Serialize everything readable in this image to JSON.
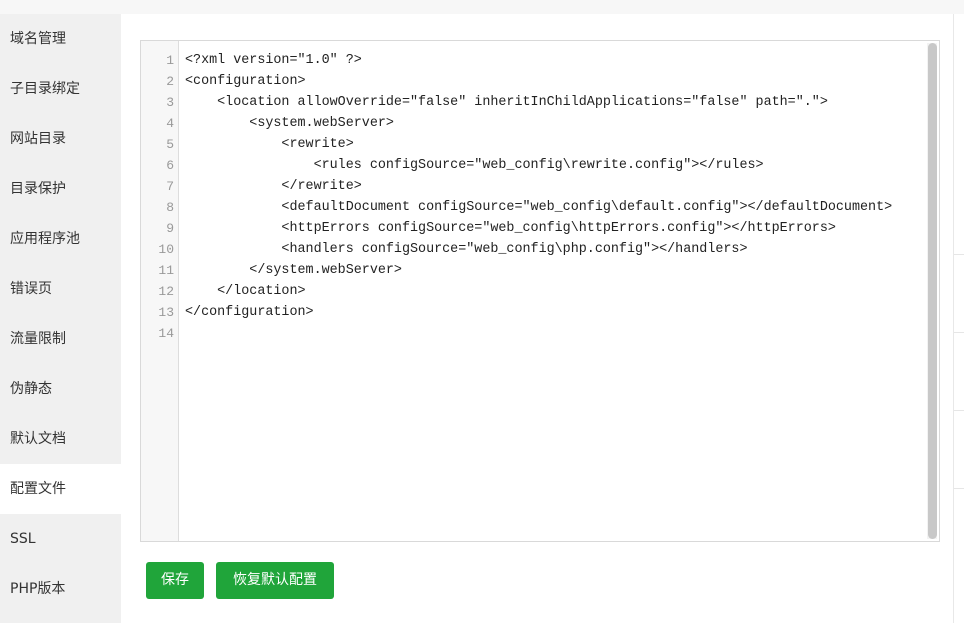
{
  "sidebar": {
    "items": [
      {
        "label": "域名管理"
      },
      {
        "label": "子目录绑定"
      },
      {
        "label": "网站目录"
      },
      {
        "label": "目录保护"
      },
      {
        "label": "应用程序池"
      },
      {
        "label": "错误页"
      },
      {
        "label": "流量限制"
      },
      {
        "label": "伪静态"
      },
      {
        "label": "默认文档"
      },
      {
        "label": "配置文件"
      },
      {
        "label": "SSL"
      },
      {
        "label": "PHP版本"
      }
    ],
    "active_label": "配置文件"
  },
  "editor": {
    "line_numbers": [
      "1",
      "2",
      "3",
      "4",
      "5",
      "6",
      "7",
      "8",
      "9",
      "10",
      "11",
      "12",
      "13",
      "14"
    ],
    "lines": [
      "<?xml version=\"1.0\" ?>",
      "<configuration>",
      "    <location allowOverride=\"false\" inheritInChildApplications=\"false\" path=\".\">",
      "        <system.webServer>",
      "            <rewrite>",
      "                <rules configSource=\"web_config\\rewrite.config\"></rules>",
      "            </rewrite>",
      "            <defaultDocument configSource=\"web_config\\default.config\"></defaultDocument>",
      "            <httpErrors configSource=\"web_config\\httpErrors.config\"></httpErrors>",
      "            <handlers configSource=\"web_config\\php.config\"></handlers>",
      "        </system.webServer>",
      "    </location>",
      "</configuration>",
      ""
    ]
  },
  "buttons": {
    "save_label": "保存",
    "restore_label": "恢复默认配置"
  },
  "colors": {
    "accent": "#20a53a",
    "sidebar_bg": "#f0f0f0",
    "gutter_bg": "#f7f7f7"
  }
}
